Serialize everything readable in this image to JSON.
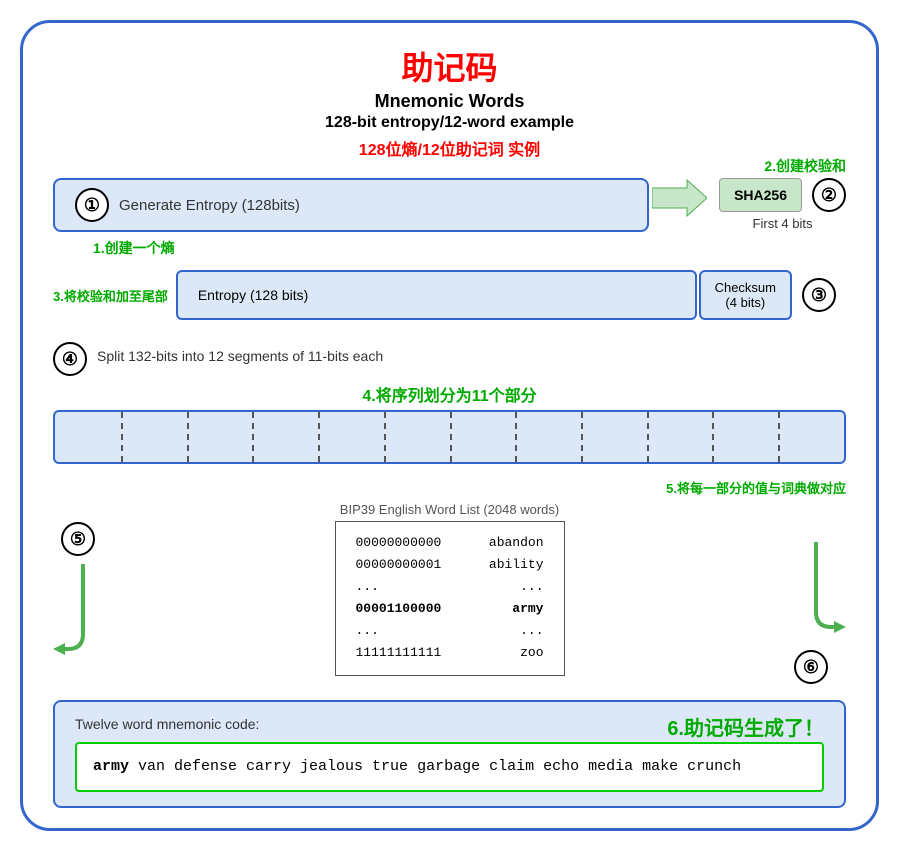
{
  "title": {
    "chinese": "助记码",
    "english_main": "Mnemonic Words",
    "english_sub": "128-bit entropy/12-word example",
    "chinese_sub": "128位熵/12位助记词 实例"
  },
  "labels": {
    "label1": "1.创建一个熵",
    "label2": "2.创建校验和",
    "label3": "3.将校验和加至尾部",
    "label4": "4.将序列划分为11个部分",
    "label5": "5.将每一部分的值与词典做对应",
    "label6": "6.助记码生成了！"
  },
  "step1": {
    "circle": "①",
    "text": "Generate Entropy (128bits)"
  },
  "step2": {
    "circle": "②",
    "sha_label": "SHA256",
    "first4": "First 4 bits"
  },
  "step3": {
    "circle": "③",
    "entropy_text": "Entropy (128 bits)",
    "checksum_text": "Checksum\n(4 bits)"
  },
  "step4": {
    "circle": "④",
    "text": "Split 132-bits into 12 segments of 11-bits each"
  },
  "step5": {
    "circle": "⑤"
  },
  "bip39": {
    "title": "BIP39 English Word List (2048 words)",
    "rows": [
      {
        "bits": "00000000000",
        "word": "abandon"
      },
      {
        "bits": "00000000001",
        "word": "ability"
      },
      {
        "bits": "...",
        "word": "..."
      },
      {
        "bits": "00001100000",
        "word": "army"
      },
      {
        "bits": "...",
        "word": "..."
      },
      {
        "bits": "11111111111",
        "word": "zoo"
      }
    ]
  },
  "step6": {
    "circle": "⑥"
  },
  "bottom": {
    "label": "Twelve word mnemonic code:",
    "mnemonic_bold": "army",
    "mnemonic_rest": " van defense carry jealous true garbage claim echo media make crunch"
  }
}
